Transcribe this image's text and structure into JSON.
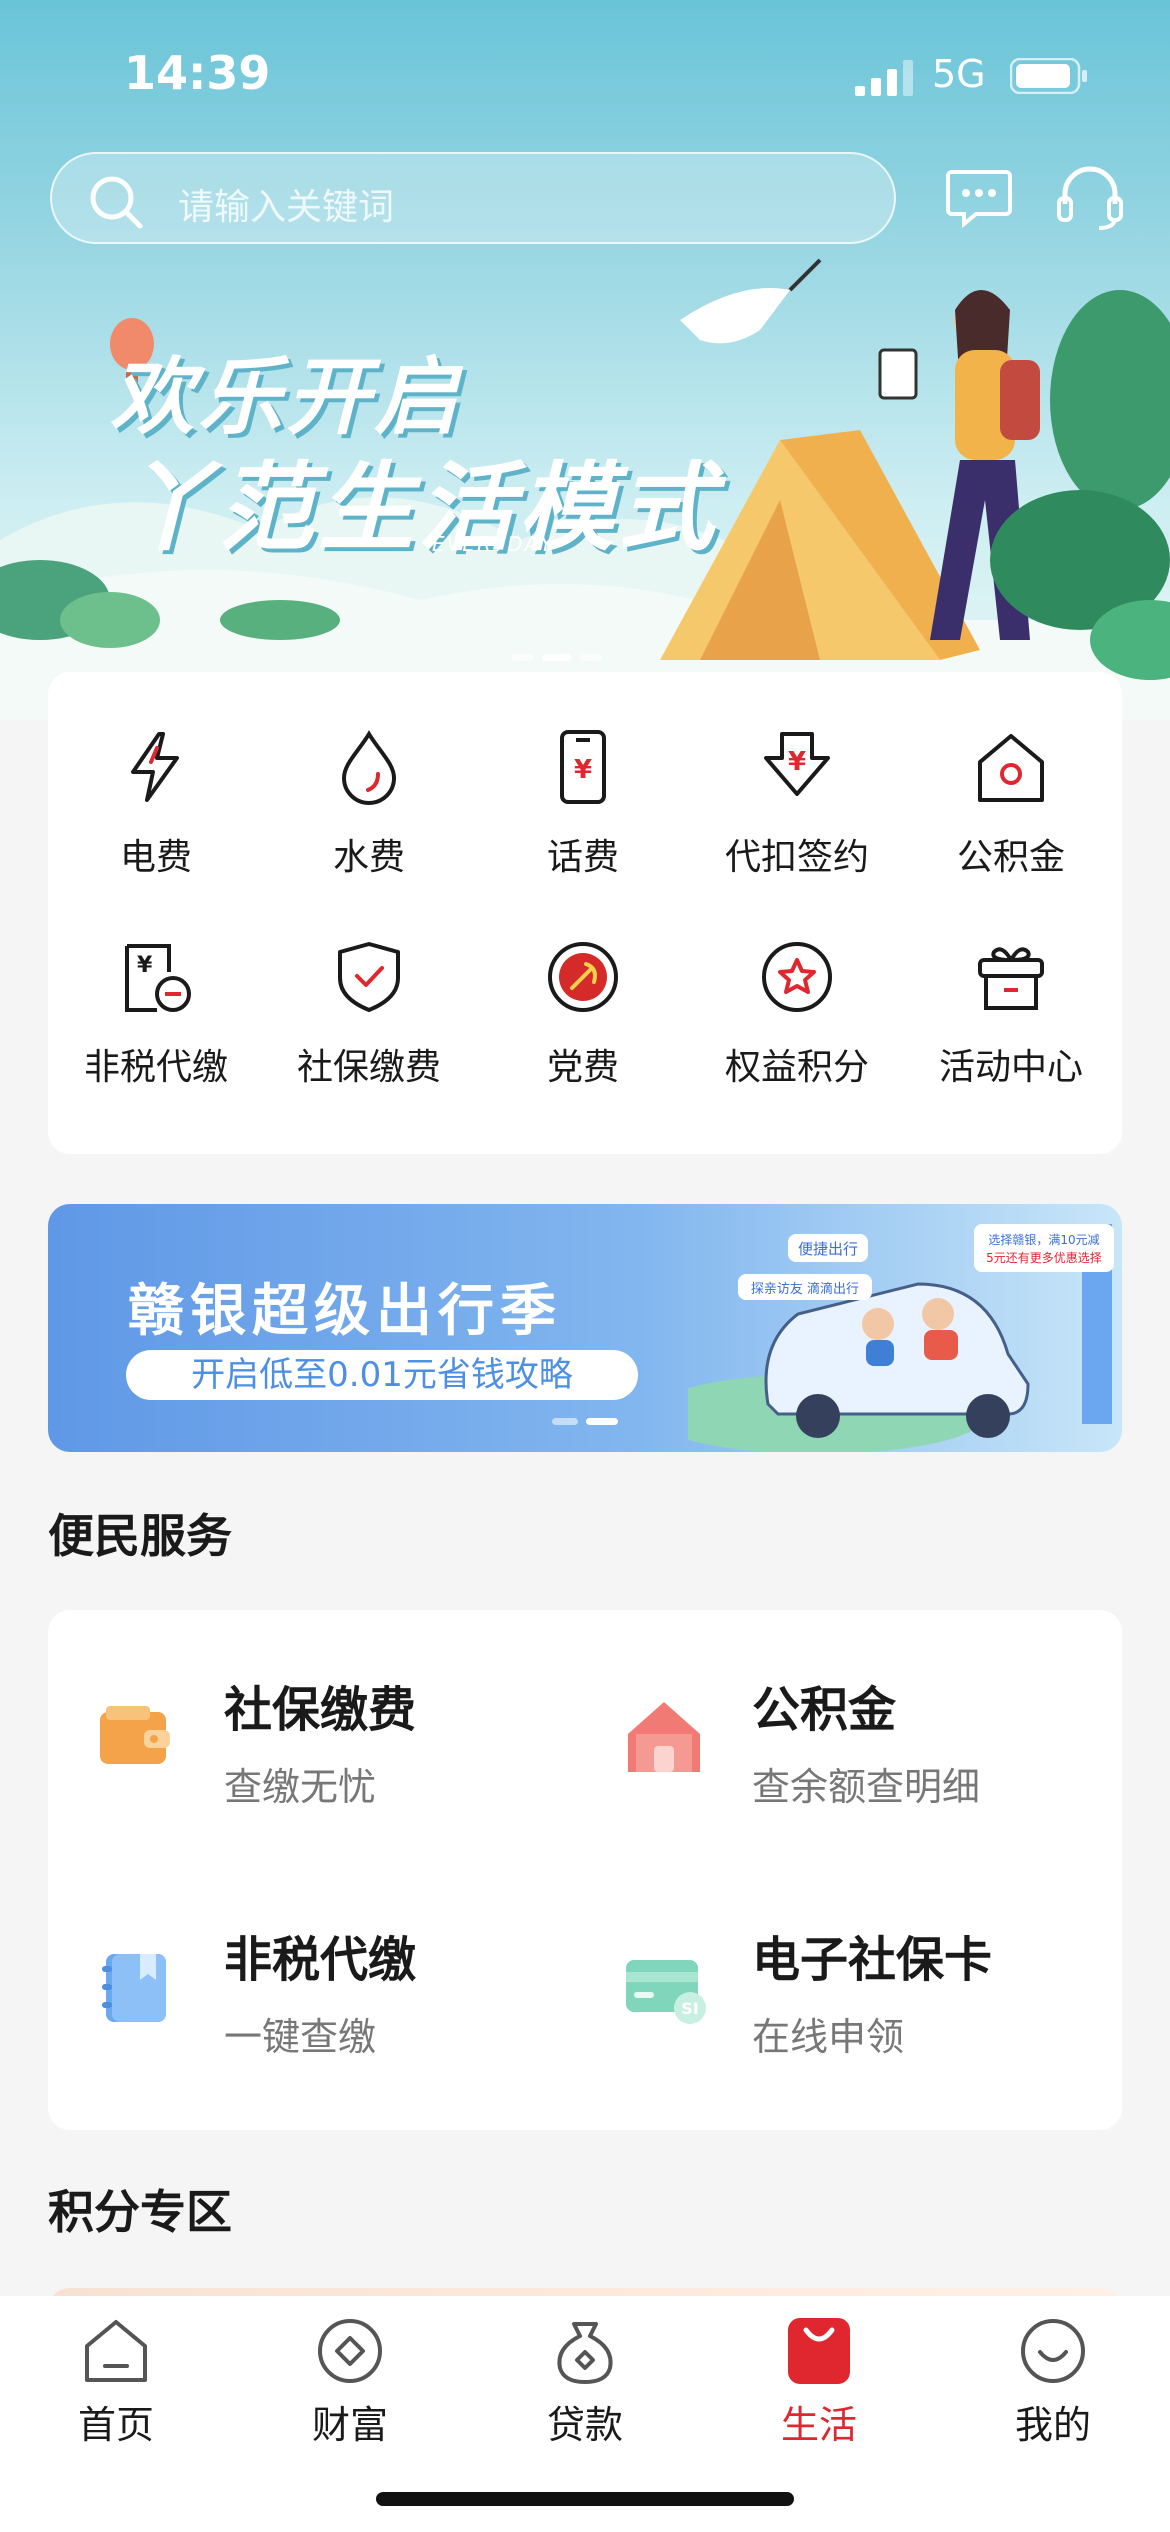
{
  "status_bar": {
    "time": "14:39",
    "network": "5G"
  },
  "search": {
    "placeholder": "请输入关键词"
  },
  "banner": {
    "line1": "欢乐开启",
    "line2": "丫范生活模式",
    "tag": "EVERYDAY"
  },
  "quick_grid": [
    {
      "label": "电费",
      "icon": "lightning-icon"
    },
    {
      "label": "水费",
      "icon": "water-drop-icon"
    },
    {
      "label": "话费",
      "icon": "phone-bill-icon"
    },
    {
      "label": "代扣签约",
      "icon": "yuan-download-icon"
    },
    {
      "label": "公积金",
      "icon": "house-icon"
    },
    {
      "label": "非税代缴",
      "icon": "tax-doc-icon"
    },
    {
      "label": "社保缴费",
      "icon": "shield-check-icon"
    },
    {
      "label": "党费",
      "icon": "party-emblem-icon"
    },
    {
      "label": "权益积分",
      "icon": "star-badge-icon"
    },
    {
      "label": "活动中心",
      "icon": "gift-box-icon"
    }
  ],
  "promo": {
    "title": "赣银超级出行季",
    "subtitle": "开启低至0.01元省钱攻略",
    "bubble1": "便捷出行",
    "bubble2": "探亲访友 滴滴出行",
    "bubble3": "选择赣银，满10元减",
    "bubble4": "5元还有更多优惠选择"
  },
  "convenience": {
    "title": "便民服务",
    "items": [
      {
        "title": "社保缴费",
        "subtitle": "查缴无忧",
        "icon": "wallet-icon"
      },
      {
        "title": "公积金",
        "subtitle": "查余额查明细",
        "icon": "home-icon"
      },
      {
        "title": "非税代缴",
        "subtitle": "一键查缴",
        "icon": "notebook-icon"
      },
      {
        "title": "电子社保卡",
        "subtitle": "在线申领",
        "icon": "social-card-icon"
      }
    ]
  },
  "points": {
    "title": "积分专区"
  },
  "tabbar": [
    {
      "label": "首页",
      "icon": "home-tab-icon"
    },
    {
      "label": "财富",
      "icon": "wealth-icon"
    },
    {
      "label": "贷款",
      "icon": "loan-bag-icon"
    },
    {
      "label": "生活",
      "icon": "shopping-bag-icon",
      "active": true
    },
    {
      "label": "我的",
      "icon": "smile-profile-icon"
    }
  ],
  "colors": {
    "accent": "#e0262f",
    "hero": "#69c4d8",
    "promo": "#5f98e6"
  }
}
